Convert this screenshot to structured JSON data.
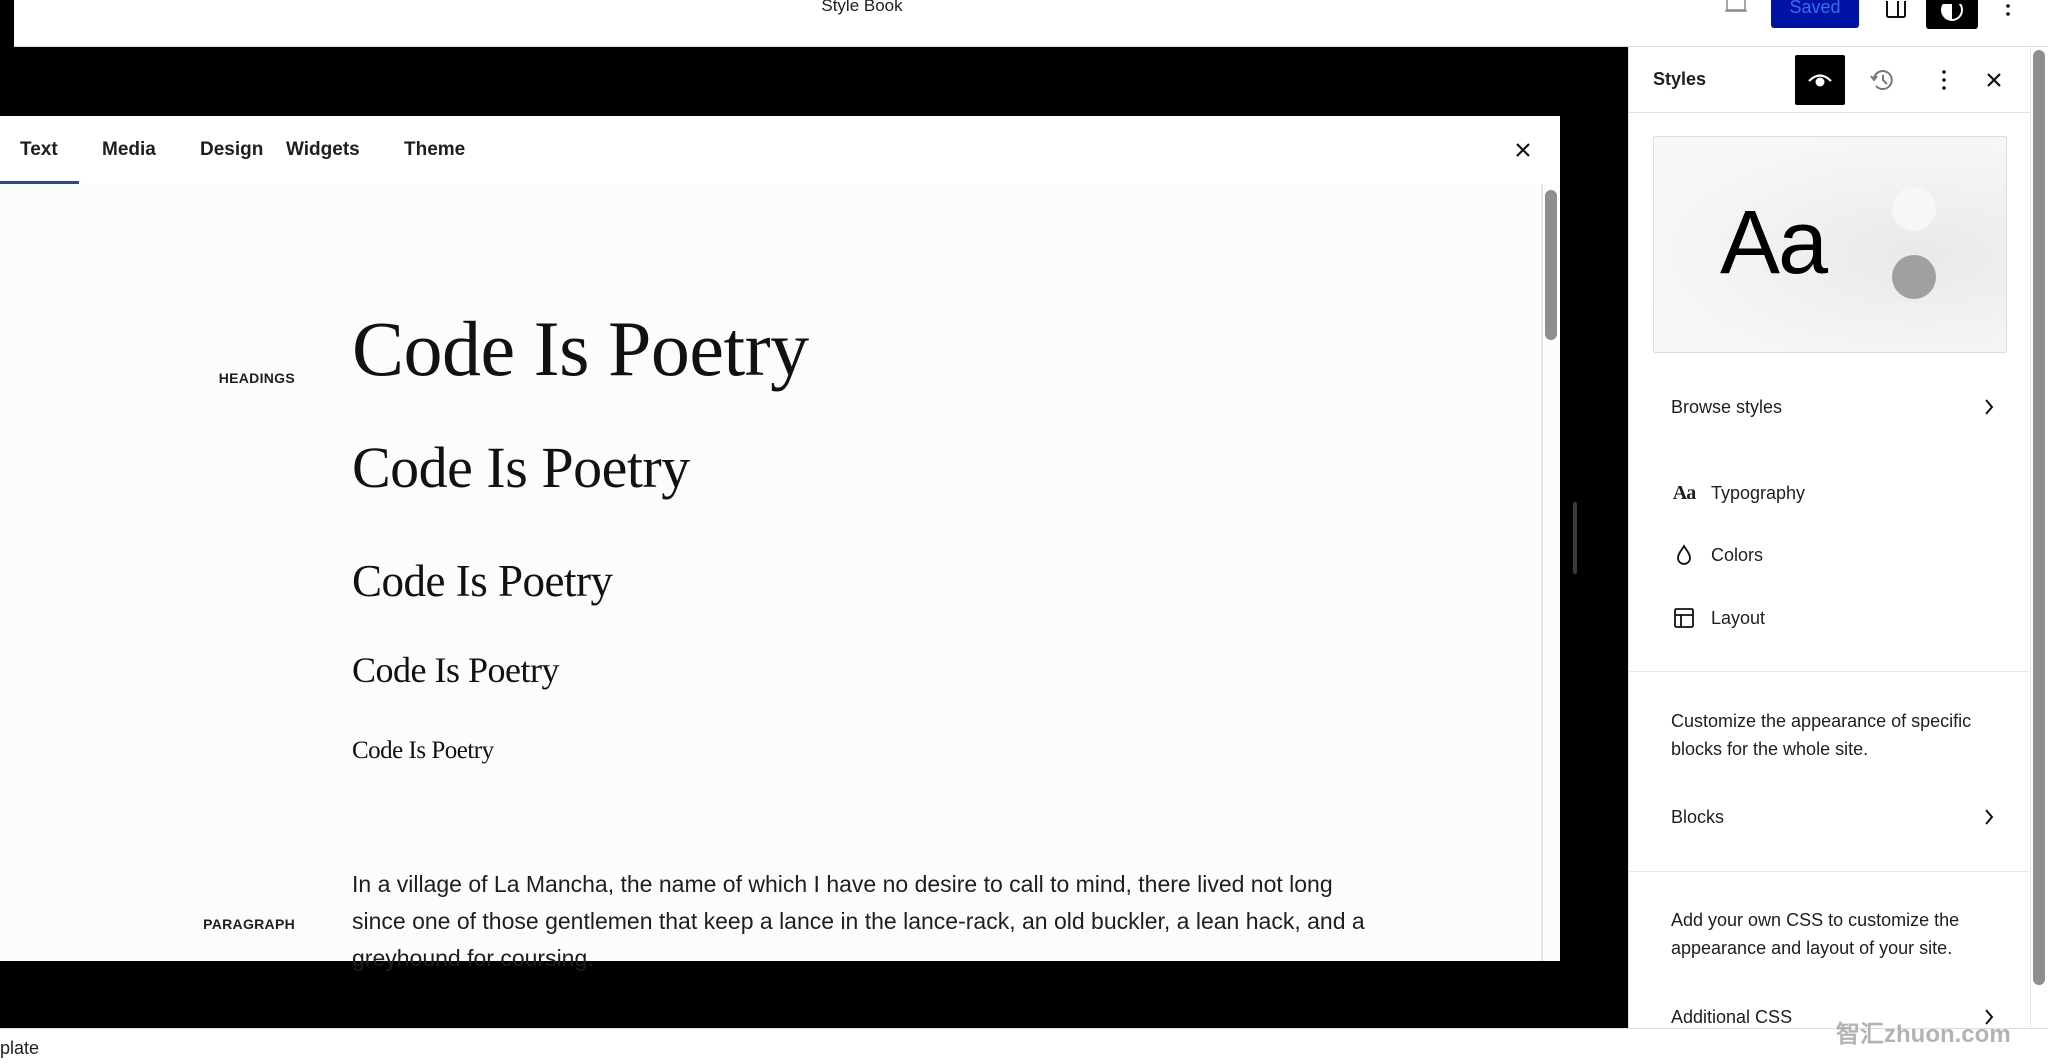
{
  "topbar": {
    "document_title": "Style Book",
    "saved_label": "Saved",
    "icons": {
      "preview": "desktop-preview-icon",
      "layout": "sidebar-toggle-icon",
      "styles": "half-circle-styles-icon",
      "more": "more-vertical-icon"
    }
  },
  "stylebook": {
    "tabs": [
      {
        "label": "Text",
        "active": true
      },
      {
        "label": "Media",
        "active": false
      },
      {
        "label": "Design",
        "active": false
      },
      {
        "label": "Widgets",
        "active": false
      },
      {
        "label": "Theme",
        "active": false
      }
    ],
    "close_icon": "close-icon",
    "sections": {
      "headings": {
        "label": "HEADINGS",
        "items": [
          "Code Is Poetry",
          "Code Is Poetry",
          "Code Is Poetry",
          "Code Is Poetry",
          "Code Is Poetry"
        ]
      },
      "paragraph": {
        "label": "PARAGRAPH",
        "text": "In a village of La Mancha, the name of which I have no desire to call to mind, there lived not long since one of those gentlemen that keep a lance in the lance-rack, an old buckler, a lean hack, and a greyhound for coursing."
      }
    }
  },
  "panel": {
    "title": "Styles",
    "header_icons": [
      "eye-icon",
      "history-icon",
      "more-vertical-icon",
      "close-icon"
    ],
    "preview": {
      "sample_text": "Aa",
      "colors": [
        "#f7f7f7",
        "#a0a0a0"
      ]
    },
    "browse_styles_label": "Browse styles",
    "menu": [
      {
        "label": "Typography",
        "icon": "typography-icon",
        "glyph": "Aa"
      },
      {
        "label": "Colors",
        "icon": "droplet-icon"
      },
      {
        "label": "Layout",
        "icon": "layout-icon"
      }
    ],
    "blocks_description": "Customize the appearance of specific blocks for the whole site.",
    "blocks_label": "Blocks",
    "css_description": "Add your own CSS to customize the appearance and layout of your site.",
    "additional_css_label": "Additional CSS"
  },
  "statusbar": {
    "text": "plate"
  },
  "watermark": "智汇zhuon.com",
  "colors": {
    "saved_button_bg": "#0013a3",
    "saved_button_text": "#3a6df0",
    "tab_active_indicator": "#1f4f8f",
    "canvas_bg": "#000000"
  }
}
